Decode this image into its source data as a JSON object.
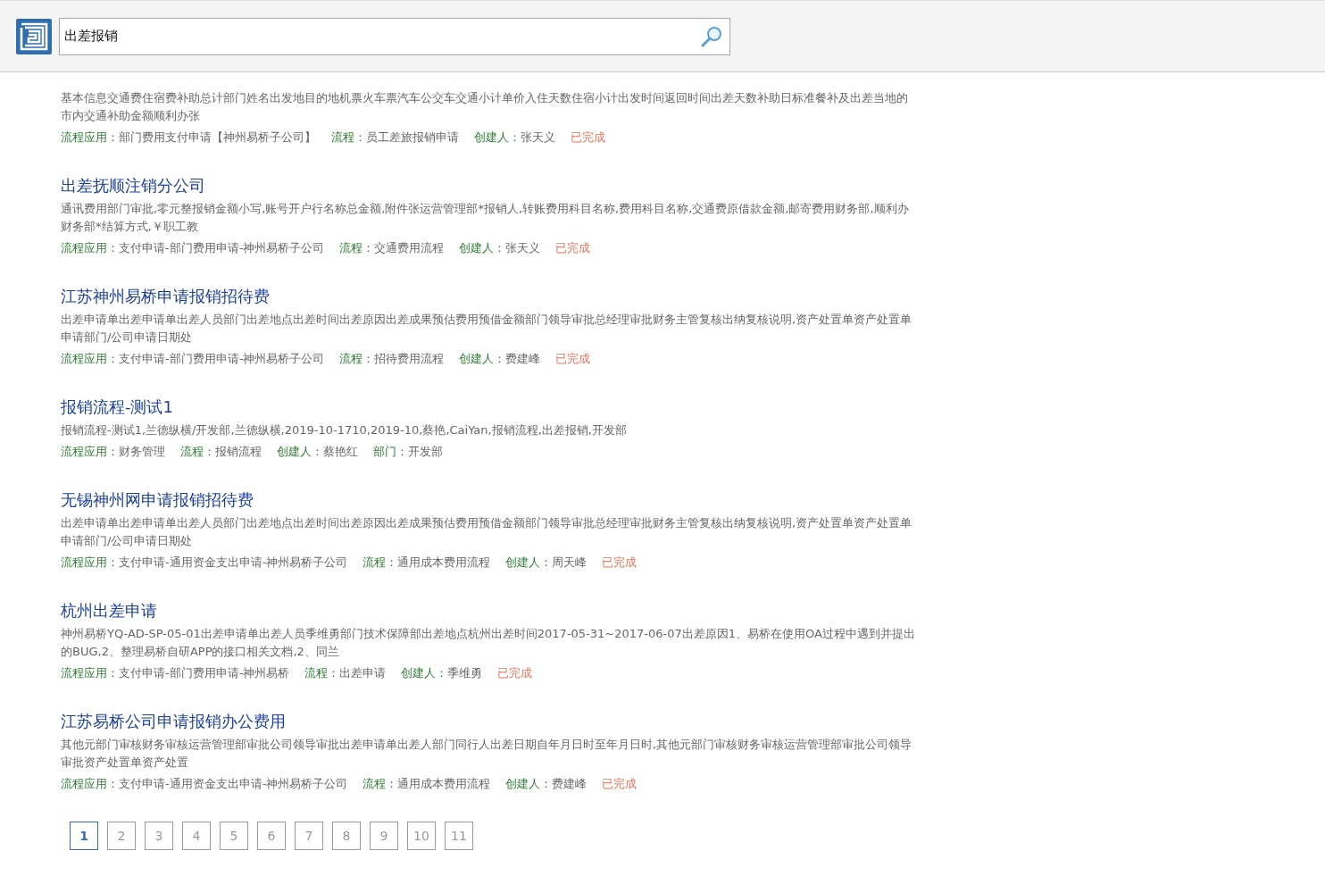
{
  "search": {
    "value": "出差报销"
  },
  "results": [
    {
      "description": "基本信息交通费住宿费补助总计部门姓名出发地目的地机票火车票汽车公交车交通小计单价入住天数住宿小计出发时间返回时间出差天数补助日标准餐补及出差当地的市内交通补助金额顺利办张",
      "meta": [
        {
          "label": "流程应用：",
          "value": "部门费用支付申请【神州易桥子公司】"
        },
        {
          "label": "流程：",
          "value": "员工差旅报销申请"
        },
        {
          "label": "创建人：",
          "value": "张天义"
        }
      ],
      "status": "已完成"
    },
    {
      "title": "出差抚顺注销分公司",
      "description": "通讯费用部门审批,零元整报销金额小写,账号开户行名称总金额,附件张运营管理部*报销人,转账费用科目名称,费用科目名称,交通费原借款金额,邮寄费用财务部,顺利办财务部*结算方式,￥职工教",
      "meta": [
        {
          "label": "流程应用：",
          "value": "支付申请-部门费用申请-神州易桥子公司"
        },
        {
          "label": "流程：",
          "value": "交通费用流程"
        },
        {
          "label": "创建人：",
          "value": "张天义"
        }
      ],
      "status": "已完成"
    },
    {
      "title": "江苏神州易桥申请报销招待费",
      "description": "出差申请单出差申请单出差人员部门出差地点出差时间出差原因出差成果预估费用预借金额部门领导审批总经理审批财务主管复核出纳复核说明,资产处置单资产处置单申请部门/公司申请日期处",
      "meta": [
        {
          "label": "流程应用：",
          "value": "支付申请-部门费用申请-神州易桥子公司"
        },
        {
          "label": "流程：",
          "value": "招待费用流程"
        },
        {
          "label": "创建人：",
          "value": "费建峰"
        }
      ],
      "status": "已完成"
    },
    {
      "title": "报销流程-测试1",
      "description": "报销流程-测试1,兰德纵横/开发部,兰德纵横,2019-10-1710,2019-10,蔡艳,CaiYan,报销流程,出差报销,开发部",
      "meta": [
        {
          "label": "流程应用：",
          "value": "财务管理"
        },
        {
          "label": "流程：",
          "value": "报销流程"
        },
        {
          "label": "创建人：",
          "value": "蔡艳红"
        },
        {
          "label": "部门：",
          "value": "开发部"
        }
      ]
    },
    {
      "title": "无锡神州网申请报销招待费",
      "description": "出差申请单出差申请单出差人员部门出差地点出差时间出差原因出差成果预估费用预借金额部门领导审批总经理审批财务主管复核出纳复核说明,资产处置单资产处置单申请部门/公司申请日期处",
      "meta": [
        {
          "label": "流程应用：",
          "value": "支付申请-通用资金支出申请-神州易桥子公司"
        },
        {
          "label": "流程：",
          "value": "通用成本费用流程"
        },
        {
          "label": "创建人：",
          "value": "周天峰"
        }
      ],
      "status": "已完成"
    },
    {
      "title": "杭州出差申请",
      "description": "神州易桥YQ-AD-SP-05-01出差申请单出差人员季维勇部门技术保障部出差地点杭州出差时间2017-05-31~2017-06-07出差原因1、易桥在使用OA过程中遇到并提出的BUG,2、整理易桥自研APP的接口相关文档,2、同兰",
      "meta": [
        {
          "label": "流程应用：",
          "value": "支付申请-部门费用申请-神州易桥"
        },
        {
          "label": "流程：",
          "value": "出差申请"
        },
        {
          "label": "创建人：",
          "value": "季维勇"
        }
      ],
      "status": "已完成"
    },
    {
      "title": "江苏易桥公司申请报销办公费用",
      "description": "其他元部门审核财务审核运营管理部审批公司领导审批出差申请单出差人部门同行人出差日期自年月日时至年月日时,其他元部门审核财务审核运营管理部审批公司领导审批资产处置单资产处置",
      "meta": [
        {
          "label": "流程应用：",
          "value": "支付申请-通用资金支出申请-神州易桥子公司"
        },
        {
          "label": "流程：",
          "value": "通用成本费用流程"
        },
        {
          "label": "创建人：",
          "value": "费建峰"
        }
      ],
      "status": "已完成"
    }
  ],
  "pagination": [
    {
      "label": "1",
      "selected": true
    },
    {
      "label": "2",
      "selected": false
    },
    {
      "label": "3",
      "selected": false
    },
    {
      "label": "4",
      "selected": false
    },
    {
      "label": "5",
      "selected": false
    },
    {
      "label": "6",
      "selected": false
    },
    {
      "label": "7",
      "selected": false
    },
    {
      "label": "8",
      "selected": false
    },
    {
      "label": "9",
      "selected": false
    },
    {
      "label": "10",
      "selected": false
    },
    {
      "label": "11",
      "selected": false
    }
  ]
}
